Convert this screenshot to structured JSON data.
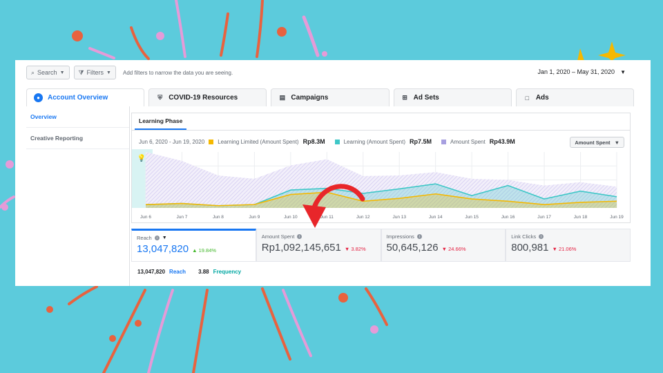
{
  "topbar": {
    "search_label": "Search",
    "filters_label": "Filters",
    "hint": "Add filters to narrow the data you are seeing.",
    "date_range": "Jan 1, 2020 – May 31, 2020"
  },
  "tabs": [
    {
      "label": "Account Overview",
      "icon": "account-icon",
      "active": true
    },
    {
      "label": "COVID-19 Resources",
      "icon": "shield-icon",
      "active": false
    },
    {
      "label": "Campaigns",
      "icon": "campaign-folder-icon",
      "active": false
    },
    {
      "label": "Ad Sets",
      "icon": "grid-icon",
      "active": false
    },
    {
      "label": "Ads",
      "icon": "ad-icon",
      "active": false
    }
  ],
  "leftnav": {
    "items": [
      {
        "label": "Overview",
        "active": true
      },
      {
        "label": "Creative Reporting",
        "active": false
      }
    ]
  },
  "panel": {
    "subtab": "Learning Phase",
    "date_range": "Jun 6, 2020 - Jun 19, 2020",
    "legend": [
      {
        "label": "Learning Limited (Amount Spent)",
        "value": "Rp8.3M",
        "color": "#f5b800"
      },
      {
        "label": "Learning (Amount Spent)",
        "value": "Rp7.5M",
        "color": "#3ec7c7"
      },
      {
        "label": "Amount Spent",
        "value": "Rp43.9M",
        "color": "#a79fe0"
      }
    ],
    "metric_select": "Amount Spent"
  },
  "chart_data": {
    "type": "area",
    "x": [
      "Jun 6",
      "Jun 7",
      "Jun 8",
      "Jun 9",
      "Jun 10",
      "Jun 11",
      "Jun 12",
      "Jun 13",
      "Jun 14",
      "Jun 15",
      "Jun 16",
      "Jun 17",
      "Jun 18",
      "Jun 19"
    ],
    "ylim": [
      0,
      100
    ],
    "grid": true,
    "annotation": "lightbulb-icon",
    "series": [
      {
        "name": "Amount Spent",
        "color": "#a79fe0",
        "values": [
          100,
          84,
          58,
          52,
          76,
          87,
          57,
          58,
          64,
          52,
          50,
          40,
          46,
          38
        ]
      },
      {
        "name": "Learning (Amount Spent)",
        "color": "#3ec7c7",
        "values": [
          6,
          8,
          4,
          6,
          32,
          35,
          26,
          34,
          43,
          22,
          40,
          16,
          30,
          20
        ]
      },
      {
        "name": "Learning Limited (Amount Spent)",
        "color": "#f5b800",
        "values": [
          6,
          8,
          4,
          6,
          24,
          28,
          12,
          17,
          25,
          16,
          12,
          6,
          10,
          12
        ]
      }
    ]
  },
  "stats": [
    {
      "label": "Reach",
      "value": "13,047,820",
      "delta": "19.84%",
      "direction": "up",
      "active": true
    },
    {
      "label": "Amount Spent",
      "value": "Rp1,092,145,651",
      "delta": "3.82%",
      "direction": "down",
      "active": false
    },
    {
      "label": "Impressions",
      "value": "50,645,126",
      "delta": "24.66%",
      "direction": "down",
      "active": false
    },
    {
      "label": "Link Clicks",
      "value": "800,981",
      "delta": "21.06%",
      "direction": "down",
      "active": false
    }
  ],
  "sub_metrics": {
    "reach_value": "13,047,820",
    "reach_label": "Reach",
    "frequency_value": "3.88",
    "frequency_label": "Frequency"
  },
  "colors": {
    "background": "#5ccbdc",
    "accent": "#1877f2",
    "arrow": "#e8262a",
    "decor_orange": "#e8623f",
    "decor_pink": "#e59bd8",
    "decor_yellow": "#f5b800"
  }
}
